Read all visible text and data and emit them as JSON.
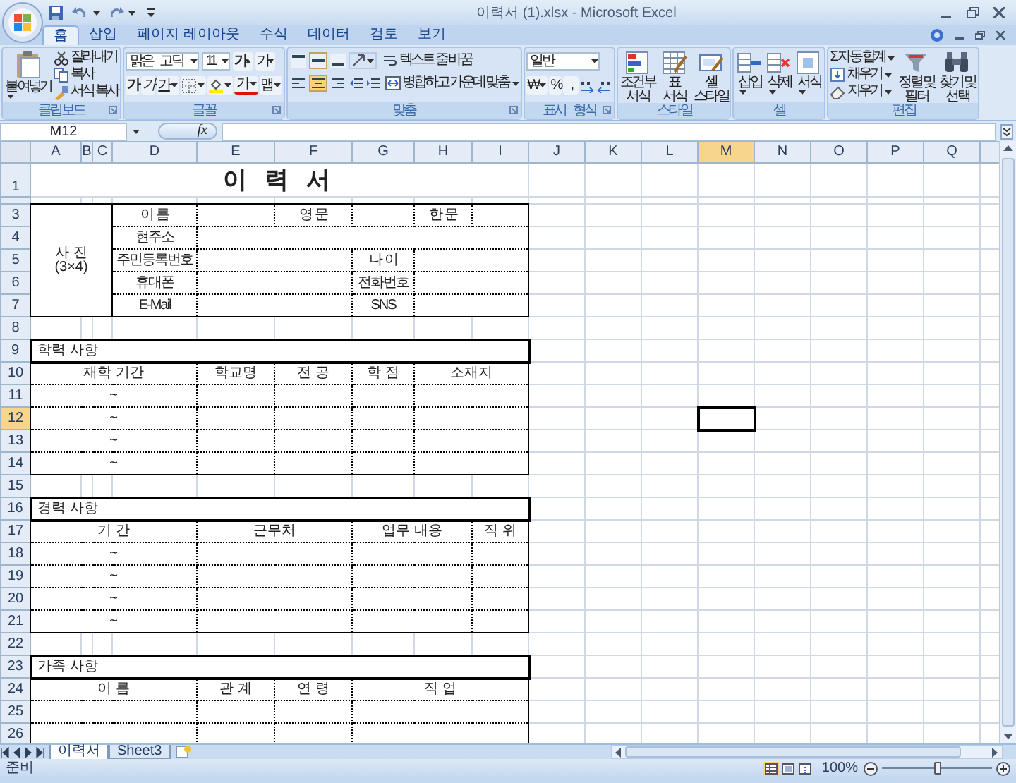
{
  "window": {
    "title": "이력서 (1).xlsx - Microsoft Excel"
  },
  "ribbon_tabs": [
    {
      "label": "홈",
      "selected": true
    },
    {
      "label": "삽입",
      "selected": false
    },
    {
      "label": "페이지 레이아웃",
      "selected": false
    },
    {
      "label": "수식",
      "selected": false
    },
    {
      "label": "데이터",
      "selected": false
    },
    {
      "label": "검토",
      "selected": false
    },
    {
      "label": "보기",
      "selected": false
    }
  ],
  "ribbon_groups": [
    {
      "kind": "clipboard",
      "label": "클립보드",
      "paste": "붙여넣기",
      "items": [
        "잘라내기",
        "복사",
        "서식 복사"
      ]
    },
    {
      "kind": "font",
      "label": "글꼴",
      "font_name": "맑은 고딕",
      "font_size": "11",
      "grow": "가",
      "shrink": "가",
      "bold": "가",
      "italic": "가",
      "underline": "가",
      "font_color": "가",
      "phonetic": "맵"
    },
    {
      "kind": "alignment",
      "label": "맞춤",
      "vertical_align": [
        {
          "selected": false
        },
        {
          "selected": true
        },
        {
          "selected": false
        }
      ],
      "horizontal_align": [
        {
          "selected": false
        },
        {
          "selected": true
        },
        {
          "selected": false
        }
      ],
      "wrap": "텍스트 줄 바꿈",
      "merge": "병합하고 가운데 맞춤"
    },
    {
      "kind": "number",
      "label": "표시 형식",
      "format": "일반",
      "currency": "₩",
      "percent": "%",
      "comma": ","
    },
    {
      "kind": "styles",
      "label": "스타일",
      "buttons": [
        "조건부 서식",
        "표 서식",
        "셀 스타일"
      ]
    },
    {
      "kind": "cells",
      "label": "셀",
      "buttons": [
        "삽입",
        "삭제",
        "서식"
      ]
    },
    {
      "kind": "editing",
      "label": "편집",
      "items": [
        "Σ 자동 합계",
        "채우기",
        "지우기"
      ],
      "buttons": [
        "정렬 및 필터",
        "찾기 및 선택"
      ]
    }
  ],
  "formula_bar": {
    "name_box": "M12",
    "function_label": "fx"
  },
  "sheet": {
    "columns": [
      {
        "label": "A",
        "selected": false
      },
      {
        "label": "B",
        "selected": false
      },
      {
        "label": "C",
        "selected": false
      },
      {
        "label": "D",
        "selected": false
      },
      {
        "label": "E",
        "selected": false
      },
      {
        "label": "F",
        "selected": false
      },
      {
        "label": "G",
        "selected": false
      },
      {
        "label": "H",
        "selected": false
      },
      {
        "label": "I",
        "selected": false
      },
      {
        "label": "J",
        "selected": false
      },
      {
        "label": "K",
        "selected": false
      },
      {
        "label": "L",
        "selected": false
      },
      {
        "label": "M",
        "selected": true
      },
      {
        "label": "N",
        "selected": false
      },
      {
        "label": "O",
        "selected": false
      },
      {
        "label": "P",
        "selected": false
      },
      {
        "label": "Q",
        "selected": false
      }
    ],
    "rows": [
      {
        "label": "1",
        "selected": false
      },
      {
        "label": "3",
        "selected": false
      },
      {
        "label": "4",
        "selected": false
      },
      {
        "label": "5",
        "selected": false
      },
      {
        "label": "6",
        "selected": false
      },
      {
        "label": "7",
        "selected": false
      },
      {
        "label": "8",
        "selected": false
      },
      {
        "label": "9",
        "selected": false
      },
      {
        "label": "10",
        "selected": false
      },
      {
        "label": "11",
        "selected": false
      },
      {
        "label": "12",
        "selected": true
      },
      {
        "label": "13",
        "selected": false
      },
      {
        "label": "14",
        "selected": false
      },
      {
        "label": "15",
        "selected": false
      },
      {
        "label": "16",
        "selected": false
      },
      {
        "label": "17",
        "selected": false
      },
      {
        "label": "18",
        "selected": false
      },
      {
        "label": "19",
        "selected": false
      },
      {
        "label": "20",
        "selected": false
      },
      {
        "label": "21",
        "selected": false
      },
      {
        "label": "22",
        "selected": false
      },
      {
        "label": "23",
        "selected": false
      },
      {
        "label": "24",
        "selected": false
      },
      {
        "label": "25",
        "selected": false
      },
      {
        "label": "26",
        "selected": false
      }
    ],
    "title": "이 력 서",
    "photo": [
      "사 진",
      "(3×4)"
    ],
    "personal": [
      {
        "labels": [
          "이 름",
          "영 문",
          "한 문"
        ]
      },
      {
        "labels": [
          "현주소"
        ]
      },
      {
        "labels": [
          "주민등록번호",
          "나 이"
        ]
      },
      {
        "labels": [
          "휴대폰",
          "전화번호"
        ]
      },
      {
        "labels": [
          "E-Mail",
          "SNS"
        ]
      }
    ],
    "education": {
      "title": "학력 사항",
      "headers": [
        "재학 기간",
        "학교명",
        "전 공",
        "학 점",
        "소재지"
      ],
      "rows": [
        "~",
        "~",
        "~",
        "~"
      ]
    },
    "career": {
      "title": "경력 사항",
      "headers": [
        "기 간",
        "근무처",
        "업무 내용",
        "직 위"
      ],
      "rows": [
        "~",
        "~",
        "~",
        "~"
      ]
    },
    "family": {
      "title": "가족 사항",
      "headers": [
        "이 름",
        "관 계",
        "연 령",
        "직 업"
      ]
    }
  },
  "sheet_tabs": [
    {
      "label": "이력서",
      "selected": true
    },
    {
      "label": "Sheet3",
      "selected": false
    }
  ],
  "status_bar": {
    "mode": "준비",
    "zoom": "100%",
    "zoom_slider": {
      "level": 0.5
    }
  }
}
